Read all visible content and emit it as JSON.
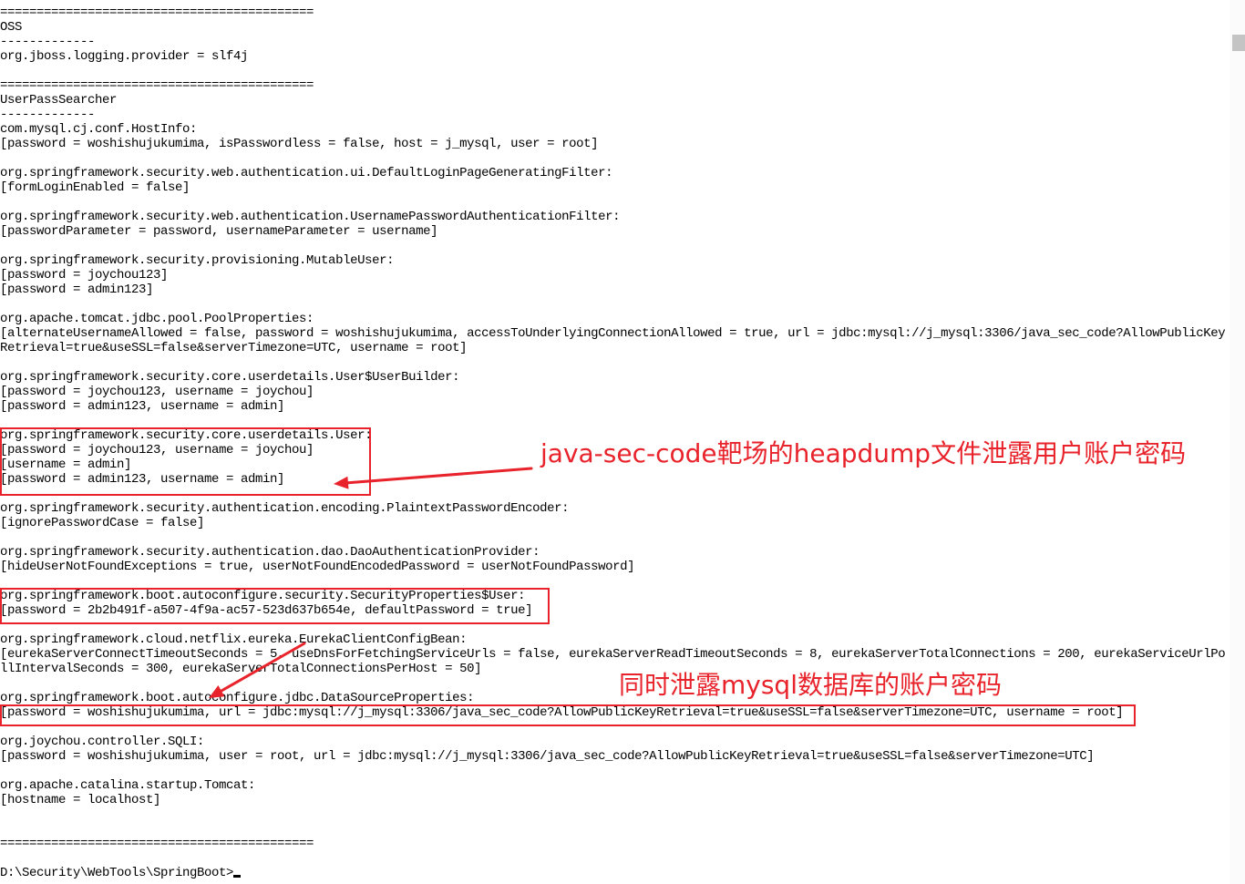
{
  "terminal": {
    "lines": [
      "===========================================",
      "OSS",
      "-------------",
      "org.jboss.logging.provider = slf4j",
      "===========================================",
      "UserPassSearcher",
      "-------------",
      "com.mysql.cj.conf.HostInfo:",
      "[password = woshishujukumima, isPasswordless = false, host = j_mysql, user = root]",
      "org.springframework.security.web.authentication.ui.DefaultLoginPageGeneratingFilter:",
      "[formLoginEnabled = false]",
      "org.springframework.security.web.authentication.UsernamePasswordAuthenticationFilter:",
      "[passwordParameter = password, usernameParameter = username]",
      "org.springframework.security.provisioning.MutableUser:",
      "[password = joychou123]",
      "[password = admin123]",
      "org.apache.tomcat.jdbc.pool.PoolProperties:",
      "[alternateUsernameAllowed = false, password = woshishujukumima, accessToUnderlyingConnectionAllowed = true, url = jdbc:mysql://j_mysql:3306/java_sec_code?AllowPublicKey",
      "Retrieval=true&useSSL=false&serverTimezone=UTC, username = root]",
      "org.springframework.security.core.userdetails.User$UserBuilder:",
      "[password = joychou123, username = joychou]",
      "[password = admin123, username = admin]",
      "org.springframework.security.core.userdetails.User:",
      "[password = joychou123, username = joychou]",
      "[username = admin]",
      "[password = admin123, username = admin]",
      "org.springframework.security.authentication.encoding.PlaintextPasswordEncoder:",
      "[ignorePasswordCase = false]",
      "org.springframework.security.authentication.dao.DaoAuthenticationProvider:",
      "[hideUserNotFoundExceptions = true, userNotFoundEncodedPassword = userNotFoundPassword]",
      "org.springframework.boot.autoconfigure.security.SecurityProperties$User:",
      "[password = 2b2b491f-a507-4f9a-ac57-523d637b654e, defaultPassword = true]",
      "org.springframework.cloud.netflix.eureka.EurekaClientConfigBean:",
      "[eurekaServerConnectTimeoutSeconds = 5, useDnsForFetchingServiceUrls = false, eurekaServerReadTimeoutSeconds = 8, eurekaServerTotalConnections = 200, eurekaServiceUrlPo",
      "llIntervalSeconds = 300, eurekaServerTotalConnectionsPerHost = 50]",
      "org.springframework.boot.autoconfigure.jdbc.DataSourceProperties:",
      "[password = woshishujukumima, url = jdbc:mysql://j_mysql:3306/java_sec_code?AllowPublicKeyRetrieval=true&useSSL=false&serverTimezone=UTC, username = root]",
      "org.joychou.controller.SQLI:",
      "[password = woshishujukumima, user = root, url = jdbc:mysql://j_mysql:3306/java_sec_code?AllowPublicKeyRetrieval=true&useSSL=false&serverTimezone=UTC]",
      "org.apache.catalina.startup.Tomcat:",
      "[hostname = localhost]",
      "==========================================="
    ],
    "prompt": "D:\\Security\\WebTools\\SpringBoot>"
  },
  "annotations": {
    "heapdump_note": "java-sec-code靶场的heapdump文件泄露用户账户密码",
    "mysql_note": "同时泄露mysql数据库的账户密码"
  },
  "colors": {
    "background": "#ffffff",
    "text": "#000000",
    "annotation": "#e8232b"
  }
}
